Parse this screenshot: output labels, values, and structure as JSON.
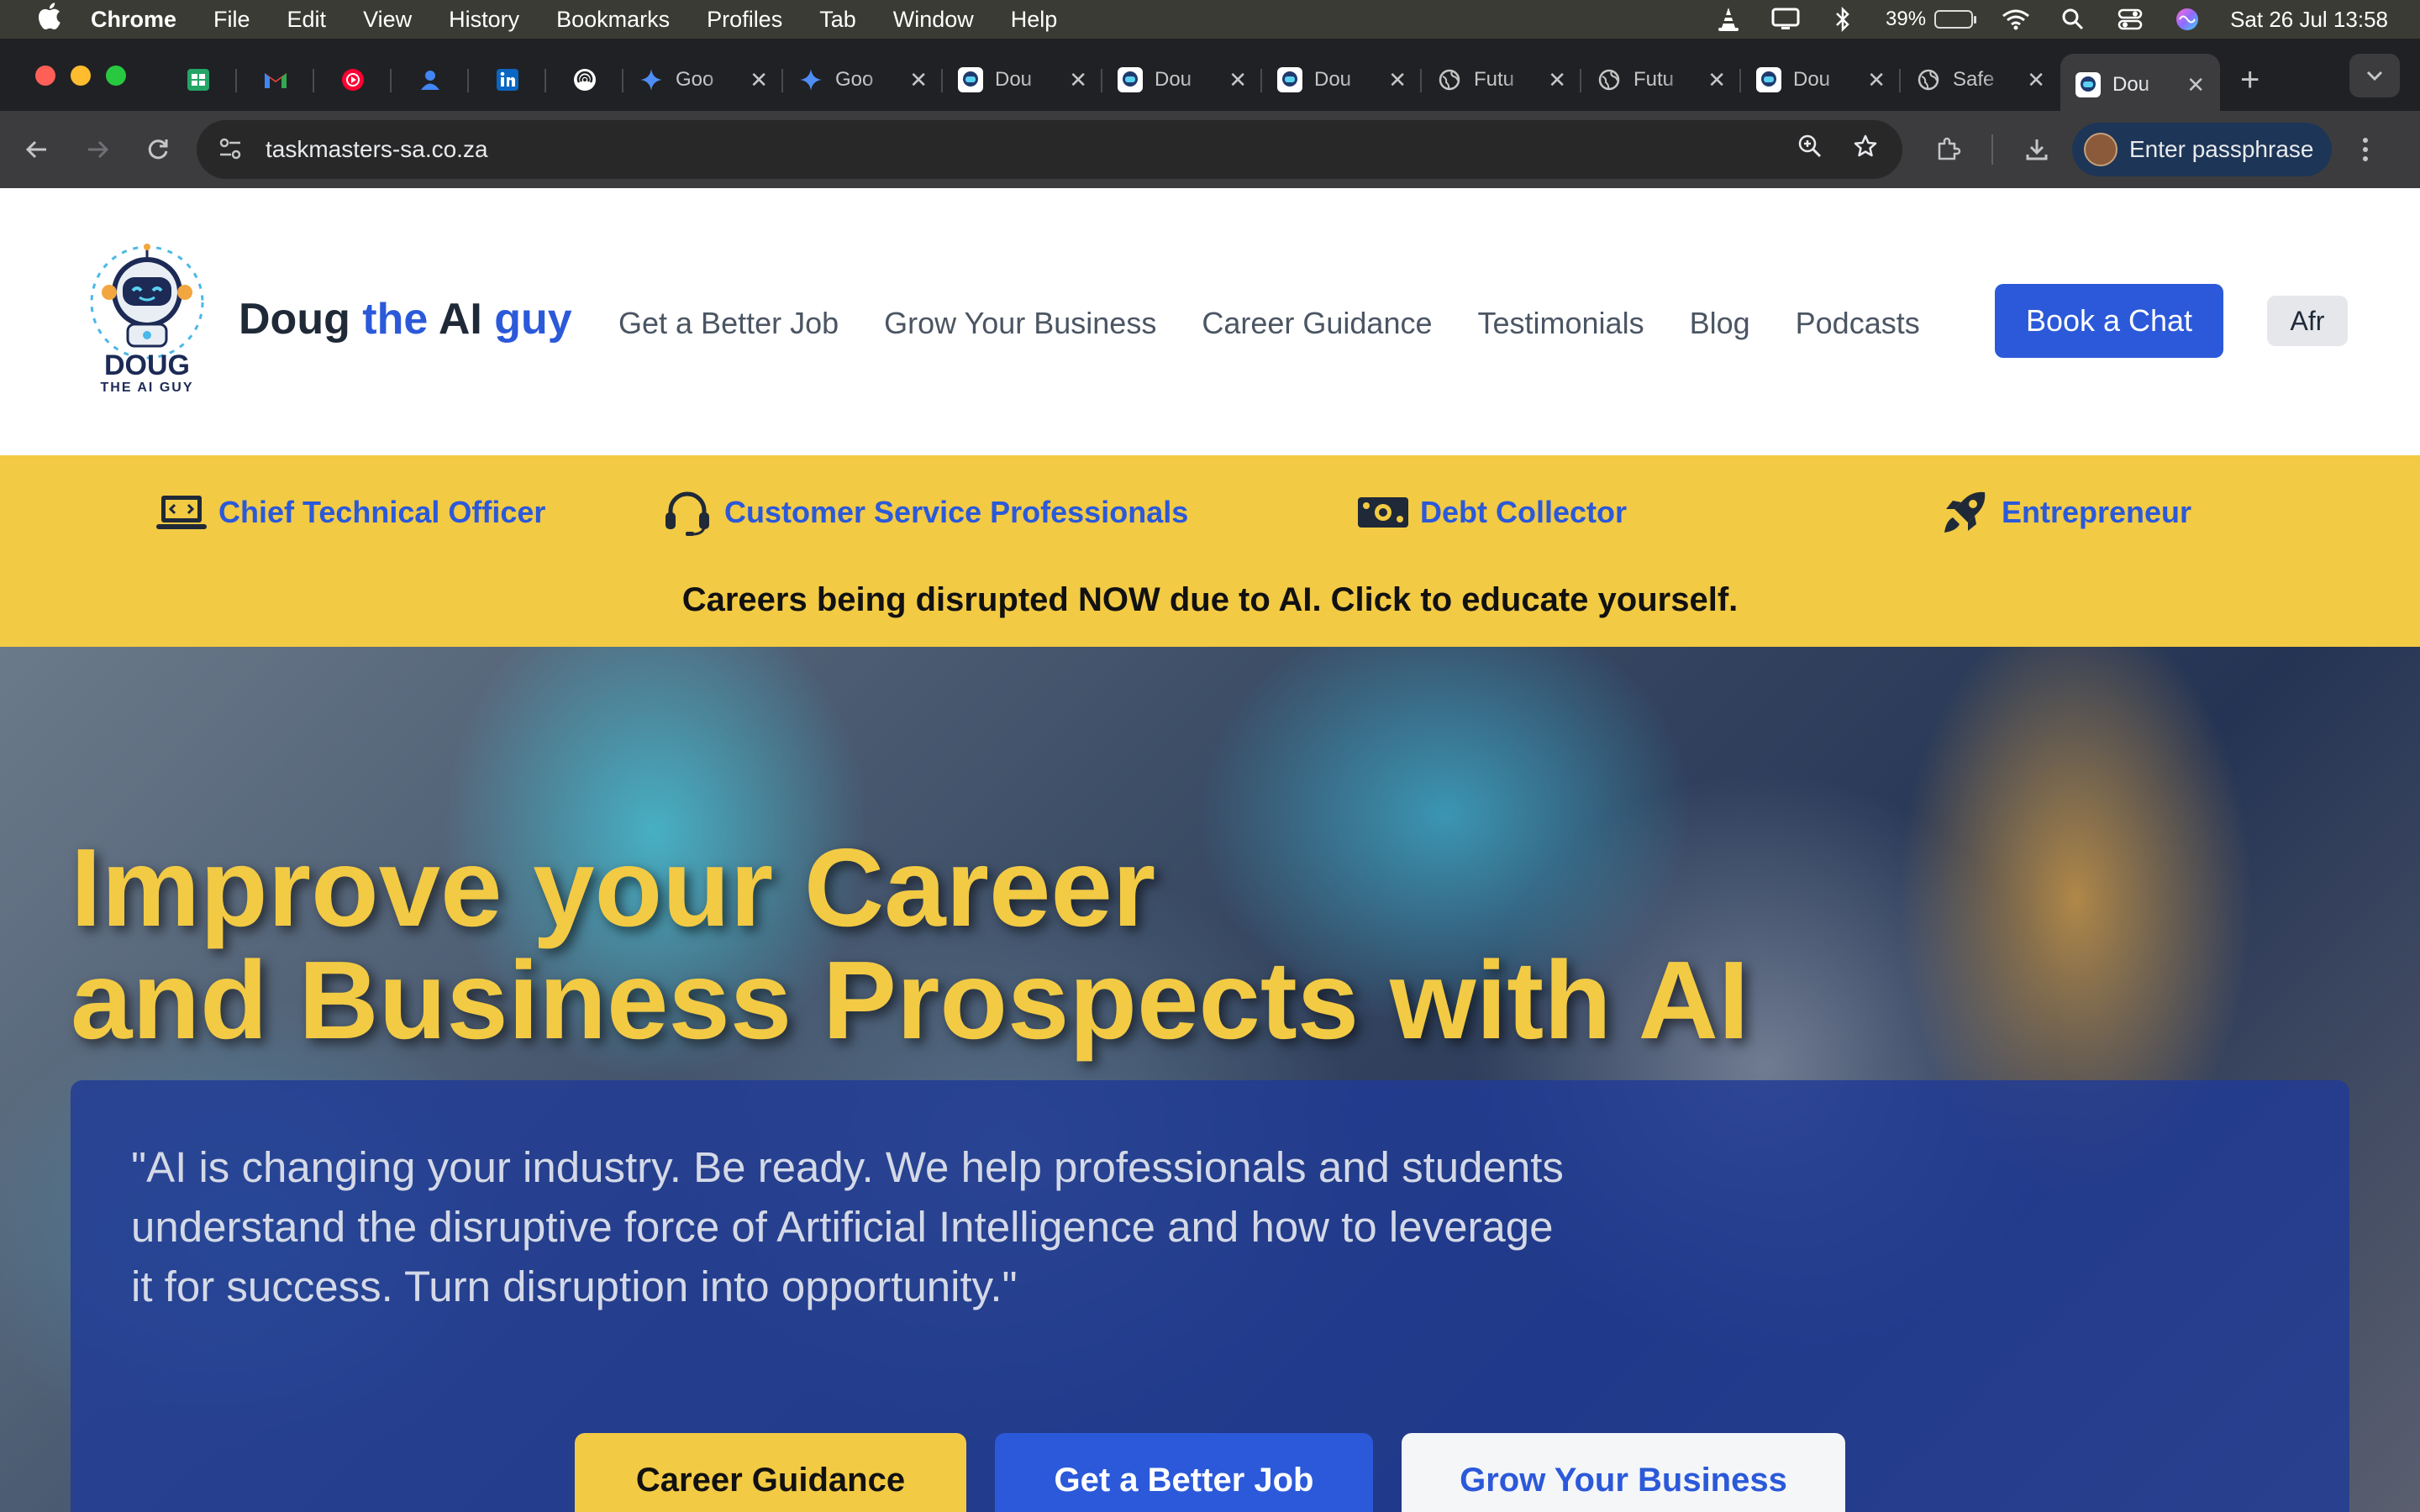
{
  "menubar": {
    "app_name": "Chrome",
    "items": [
      "File",
      "Edit",
      "View",
      "History",
      "Bookmarks",
      "Profiles",
      "Tab",
      "Window",
      "Help"
    ],
    "battery_percent": "39%",
    "battery_level": 0.39,
    "clock": "Sat 26 Jul  13:58"
  },
  "tabs": {
    "pinned_icons": [
      "sheets-icon",
      "gmail-icon",
      "youtube-music-icon",
      "contacts-icon",
      "linkedin-icon",
      "podcast-icon"
    ],
    "normal": [
      {
        "title": "Goo",
        "icon": "gemini-icon"
      },
      {
        "title": "Goo",
        "icon": "gemini-icon"
      },
      {
        "title": "Dou",
        "icon": "doug-favicon"
      },
      {
        "title": "Dou",
        "icon": "doug-favicon"
      },
      {
        "title": "Dou",
        "icon": "doug-favicon"
      },
      {
        "title": "Futu",
        "icon": "globe-icon"
      },
      {
        "title": "Futu",
        "icon": "globe-icon"
      },
      {
        "title": "Dou",
        "icon": "doug-favicon"
      },
      {
        "title": "Safe",
        "icon": "globe-icon"
      },
      {
        "title": "Dou",
        "icon": "doug-favicon",
        "active": true
      }
    ],
    "close_glyph": "✕",
    "new_tab_glyph": "+"
  },
  "toolbar": {
    "url": "taskmasters-sa.co.za",
    "profile_label": "Enter passphrase"
  },
  "site": {
    "logo_text_1": "DOUG",
    "logo_text_2": "THE AI GUY",
    "brand": {
      "w1": "Doug",
      "w2": " the",
      "w3": " AI",
      "w4": " guy"
    },
    "nav": [
      "Get a Better Job",
      "Grow Your Business",
      "Career Guidance",
      "Testimonials",
      "Blog",
      "Podcasts"
    ],
    "cta": "Book a Chat",
    "lang": "Afr",
    "ticker": {
      "items": [
        {
          "label": "Chief Technical Officer",
          "icon": "laptop-code-icon"
        },
        {
          "label": "Customer Service Professionals",
          "icon": "headset-icon"
        },
        {
          "label": "Debt Collector",
          "icon": "money-bill-icon"
        },
        {
          "label": "Entrepreneur",
          "icon": "rocket-icon"
        }
      ],
      "message": "Careers being disrupted NOW due to AI. Click to educate yourself."
    },
    "hero": {
      "title_line1": "Improve your Career",
      "title_line2": "and Business Prospects with AI",
      "quote": "\"AI is changing your industry. Be ready. We help professionals and students understand the disruptive force of Artificial Intelligence and how to leverage it for success. Turn disruption into opportunity.\"",
      "buttons": [
        "Career Guidance",
        "Get a Better Job",
        "Grow Your Business"
      ]
    }
  },
  "colors": {
    "accent_blue": "#2b59d9",
    "accent_yellow": "#f2ca44",
    "hero_card": "#203a96"
  }
}
